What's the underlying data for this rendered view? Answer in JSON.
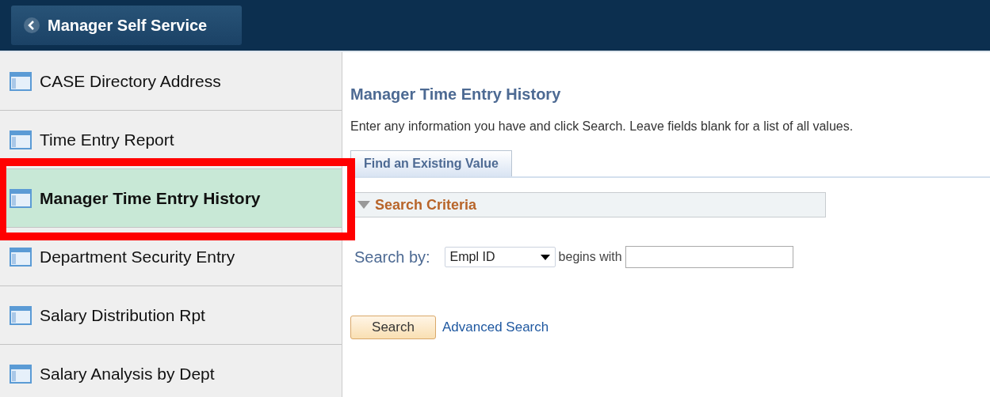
{
  "header": {
    "back_button": "Manager Self Service"
  },
  "sidebar": {
    "items": [
      {
        "label": "CASE Directory Address",
        "selected": false,
        "highlighted": false
      },
      {
        "label": "Time Entry Report",
        "selected": false,
        "highlighted": false
      },
      {
        "label": "Manager Time Entry History",
        "selected": true,
        "highlighted": true
      },
      {
        "label": "Department Security Entry",
        "selected": false,
        "highlighted": false
      },
      {
        "label": "Salary Distribution Rpt",
        "selected": false,
        "highlighted": false
      },
      {
        "label": "Salary Analysis by Dept",
        "selected": false,
        "highlighted": false
      }
    ]
  },
  "page": {
    "title": "Manager Time Entry History",
    "instructions": "Enter any information you have and click Search. Leave fields blank for a list of all values.",
    "tabs": [
      {
        "label": "Find an Existing Value",
        "selected": true
      }
    ],
    "section": {
      "title": "Search Criteria",
      "expanded": true
    },
    "search_by_label": "Search by:",
    "search_by_value": "Empl ID",
    "operator": "begins with",
    "search_button": "Search",
    "advanced_link": "Advanced Search"
  }
}
